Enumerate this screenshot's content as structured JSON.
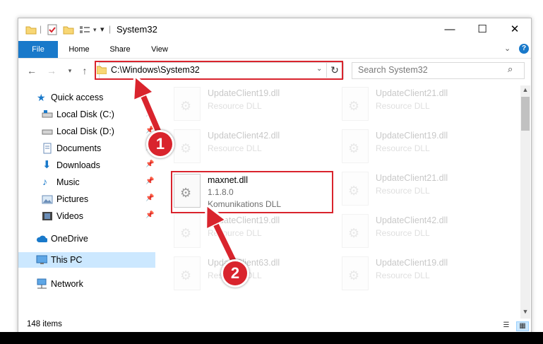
{
  "window": {
    "title": "System32",
    "minimize": "—",
    "maximize": "☐",
    "close": "✕"
  },
  "ribbon": {
    "tabs": [
      "File",
      "Home",
      "Share",
      "View"
    ]
  },
  "address": {
    "path": "C:\\Windows\\System32",
    "search_placeholder": "Search System32"
  },
  "nav": {
    "items": [
      {
        "label": "Quick access"
      },
      {
        "label": "Local Disk (C:)"
      },
      {
        "label": "Local Disk (D:)"
      },
      {
        "label": "Documents"
      },
      {
        "label": "Downloads"
      },
      {
        "label": "Music"
      },
      {
        "label": "Pictures"
      },
      {
        "label": "Videos"
      },
      {
        "label": "OneDrive"
      },
      {
        "label": "This PC"
      },
      {
        "label": "Network"
      }
    ]
  },
  "files": {
    "highlighted": {
      "name": "maxnet.dll",
      "version": "1.1.8.0",
      "description": "Komunikations DLL"
    },
    "faded": [
      {
        "name": "UpdateClient19.dll",
        "sub": "Resource DLL"
      },
      {
        "name": "UpdateClient21.dll",
        "sub": "Resource DLL"
      },
      {
        "name": "UpdateClient42.dll",
        "sub": "Resource DLL"
      },
      {
        "name": "UpdateClient19.dll",
        "sub": "Resource DLL"
      },
      {
        "name": "UpdateClient21.dll",
        "sub": "Resource DLL"
      },
      {
        "name": "UpdateClient19.dll",
        "sub": "Resource DLL"
      },
      {
        "name": "UpdateClient42.dll",
        "sub": "Resource DLL"
      },
      {
        "name": "UpdateClient63.dll",
        "sub": "Resource DLL"
      },
      {
        "name": "UpdateClient19.dll",
        "sub": "Resource DLL"
      }
    ]
  },
  "status": {
    "count": "148 items"
  },
  "annotations": {
    "step1": "1",
    "step2": "2"
  },
  "colors": {
    "accent": "#1979ca",
    "highlight_red": "#d9242d",
    "selection": "#cce8ff"
  }
}
